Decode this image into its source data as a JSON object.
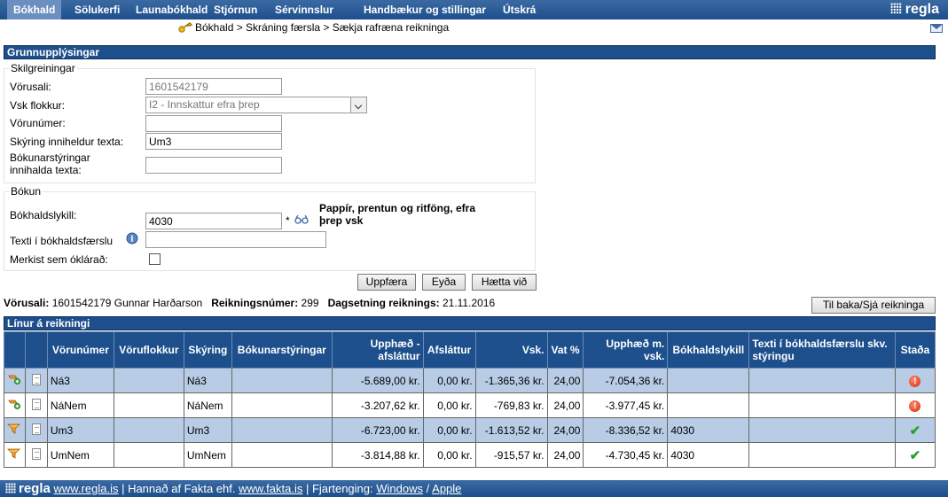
{
  "nav": {
    "items": [
      "Bókhald",
      "Sölukerfi",
      "Launabókhald",
      "Stjórnun",
      "Sérvinnslur",
      "Handbækur og stillingar",
      "Útskrá"
    ],
    "brand": "regla"
  },
  "breadcrumb": "Bókhald > Skráning færsla > Sækja rafræna reikninga",
  "basic": {
    "title": "Grunnupplýsingar",
    "filter_legend": "Skilgreiningar",
    "vendor_label": "Vörusali:",
    "vendor_value": "1601542179",
    "vat_label": "Vsk flokkur:",
    "vat_value": "I2 - Innskattur efra þrep",
    "product_label": "Vörunúmer:",
    "product_value": "",
    "desc_label": "Skýring inniheldur texta:",
    "desc_value": "Um3",
    "booking_instr_label_1": "Bókunarstýringar",
    "booking_instr_label_2": "innihalda texta:",
    "booking_instr_value": "",
    "posting_legend": "Bókun",
    "account_label": "Bókhaldslykill:",
    "account_value": "4030",
    "account_required": "*",
    "account_desc": "Pappír, prentun og ritföng, efra þrep vsk",
    "text_label": "Texti í bókhaldsfærslu",
    "text_value": "",
    "unclear_label": "Merkist sem óklárað:",
    "buttons": {
      "update": "Uppfæra",
      "delete": "Eyða",
      "cancel": "Hætta við"
    }
  },
  "invoice": {
    "vendor_label": "Vörusali:",
    "vendor_value": "1601542179 Gunnar Harðarson",
    "number_label": "Reikningsnúmer:",
    "number_value": "299",
    "date_label": "Dagsetning reiknings:",
    "date_value": "21.11.2016",
    "back_button": "Til baka/Sjá reikninga"
  },
  "lines": {
    "title": "Línur á reikningi",
    "headers": [
      "",
      "",
      "Vörunúmer",
      "Vöruflokkur",
      "Skýring",
      "Bókunarstýringar",
      "Upphæð - afsláttur",
      "Afsláttur",
      "Vsk.",
      "Vat %",
      "Upphæð m. vsk.",
      "Bókhaldslykill",
      "Texti í bókhaldsfærslu skv. stýringu",
      "Staða"
    ],
    "rows": [
      {
        "product": "Ná3",
        "group": "",
        "desc": "Ná3",
        "instr": "",
        "amount": "-5.689,00 kr.",
        "discount": "0,00 kr.",
        "vat": "-1.365,36 kr.",
        "vat_pct": "24,00",
        "total": "-7.054,36 kr.",
        "account": "",
        "text": "",
        "status": "error"
      },
      {
        "product": "NáNem",
        "group": "",
        "desc": "NáNem",
        "instr": "",
        "amount": "-3.207,62 kr.",
        "discount": "0,00 kr.",
        "vat": "-769,83 kr.",
        "vat_pct": "24,00",
        "total": "-3.977,45 kr.",
        "account": "",
        "text": "",
        "status": "error"
      },
      {
        "product": "Um3",
        "group": "",
        "desc": "Um3",
        "instr": "",
        "amount": "-6.723,00 kr.",
        "discount": "0,00 kr.",
        "vat": "-1.613,52 kr.",
        "vat_pct": "24,00",
        "total": "-8.336,52 kr.",
        "account": "4030",
        "text": "",
        "status": "ok"
      },
      {
        "product": "UmNem",
        "group": "",
        "desc": "UmNem",
        "instr": "",
        "amount": "-3.814,88 kr.",
        "discount": "0,00 kr.",
        "vat": "-915,57 kr.",
        "vat_pct": "24,00",
        "total": "-4.730,45 kr.",
        "account": "4030",
        "text": "",
        "status": "ok"
      }
    ]
  },
  "footer": {
    "brand": "regla",
    "site_link": "www.regla.is",
    "made_by": "| Hannað af Fakta ehf.",
    "fakta_link": "www.fakta.is",
    "remote": "| Fjartenging:",
    "windows": "Windows",
    "sep": "/",
    "apple": "Apple"
  },
  "colors": {
    "nav_bg": "#1d4f8c",
    "active_tab": "#6b8fc0",
    "alt_row": "#b8cce6",
    "error": "#d62b0b",
    "ok": "#2aa12a"
  }
}
